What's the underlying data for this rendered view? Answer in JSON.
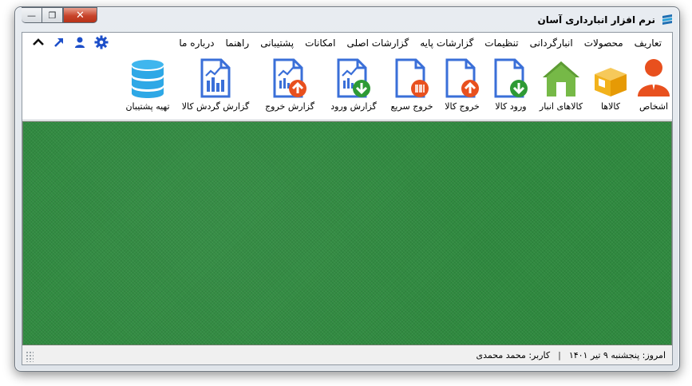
{
  "window": {
    "title": "نرم افزار انبارداری آسان",
    "close_glyph": "✕",
    "max_glyph": "❐",
    "min_glyph": "—"
  },
  "menu": {
    "items": [
      "تعاریف",
      "محصولات",
      "انبارگردانی",
      "تنظیمات",
      "گزارشات پایه",
      "گزارشات اصلی",
      "امکانات",
      "پشتیبانی",
      "راهنما",
      "درباره ما"
    ]
  },
  "quick_icons": [
    "gear-icon",
    "user-icon",
    "arrow-up-right-icon",
    "chevron-up-icon"
  ],
  "toolbar": {
    "items": [
      {
        "label": "اشخاص",
        "icon": "person-icon"
      },
      {
        "label": "کالاها",
        "icon": "box-icon"
      },
      {
        "label": "کالاهای انبار",
        "icon": "warehouse-icon"
      },
      {
        "label": "ورود کالا",
        "icon": "document-in-icon"
      },
      {
        "label": "خروج کالا",
        "icon": "document-out-icon"
      },
      {
        "label": "خروج سریع",
        "icon": "barcode-document-icon"
      },
      {
        "label": "گزارش ورود",
        "icon": "report-in-icon"
      },
      {
        "label": "گزارش خروج",
        "icon": "report-out-icon"
      },
      {
        "label": "گزارش گردش کالا",
        "icon": "report-icon"
      },
      {
        "label": "تهیه پشتیبان",
        "icon": "database-icon"
      }
    ]
  },
  "colors": {
    "workspace": "#2f8a3f",
    "accent_blue": "#3a6fd8",
    "orange": "#e8501e",
    "green": "#2e9a35"
  },
  "status": {
    "today": "امروز: پنجشنبه ۹ تیر ۱۴۰۱",
    "user": "کاربر: محمد محمدی"
  }
}
